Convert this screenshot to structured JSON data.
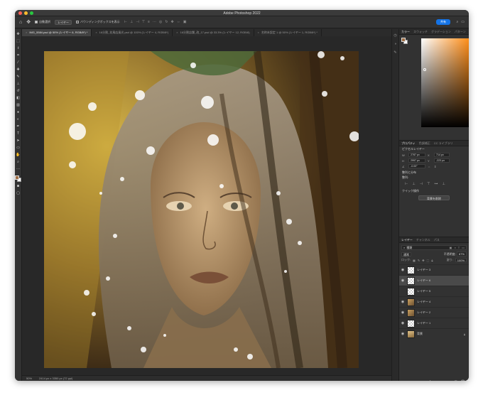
{
  "app": {
    "title": "Adobe Photoshop 2022"
  },
  "colors": {
    "close": "#ff5f57",
    "minimize": "#febc2e",
    "zoom": "#28c840",
    "share": "#1473e6",
    "fg": "#a06d43",
    "bg": "#ffffff"
  },
  "options_bar": {
    "auto_select_label": "自動選択",
    "layer_select": "レイヤー",
    "bbox_label": "バウンディングボックスを表示",
    "share_label": "共有"
  },
  "tabs": [
    {
      "label": "IMG_5584.psd @ 50% (レイヤー 6, RGB/8*) *",
      "active": true
    },
    {
      "label": "16分割_花鳥店風光.psd @ 100% (レイヤー 4, RGB/8*)",
      "active": false
    },
    {
      "label": "16分割店舗_改_17.psd @ 33.3% (レイヤー 12, RGB/8)",
      "active": false
    },
    {
      "label": "名称未設定 1 @ 50% (レイヤー 1, RGB/8*) *",
      "active": false
    }
  ],
  "status": {
    "zoom": "50%",
    "doc_size": "2414 px x 3350 px (72 ppi)"
  },
  "panels": {
    "color_tabs": [
      "カラー",
      "スウォッチ",
      "グラデーション",
      "パターン"
    ],
    "props_tabs": [
      "プロパティ",
      "色調補正",
      "CC ライブラリ"
    ],
    "pixel_layer": "ピクセルレイヤー",
    "W": "2787 px",
    "X": "714 px",
    "H": "2997 px",
    "Y": "-223 px",
    "angle": "-0.00°",
    "align_section": "整列と分布",
    "align_label": "整列:",
    "quick_actions": "クイック操作",
    "quick_button": "背景を削除"
  },
  "layers": {
    "tabs": [
      "レイヤー",
      "チャンネル",
      "パス"
    ],
    "kind": "種類",
    "blend": "通常",
    "opacity_label": "不透明度:",
    "opacity": "67%",
    "lock_label": "ロック:",
    "fill_label": "塗り:",
    "fill": "100%",
    "items": [
      {
        "name": "レイヤー 3",
        "visible": true,
        "selected": false,
        "thumb": "trans"
      },
      {
        "name": "レイヤー 6",
        "visible": true,
        "selected": true,
        "thumb": "trans"
      },
      {
        "name": "レイヤー 5",
        "visible": false,
        "selected": false,
        "thumb": "trans"
      },
      {
        "name": "レイヤー 4",
        "visible": true,
        "selected": false,
        "thumb": "img"
      },
      {
        "name": "レイヤー 2",
        "visible": true,
        "selected": false,
        "thumb": "img"
      },
      {
        "name": "レイヤー 1",
        "visible": true,
        "selected": false,
        "thumb": "trans"
      },
      {
        "name": "背景",
        "visible": true,
        "selected": false,
        "thumb": "bg",
        "locked": true
      }
    ]
  }
}
